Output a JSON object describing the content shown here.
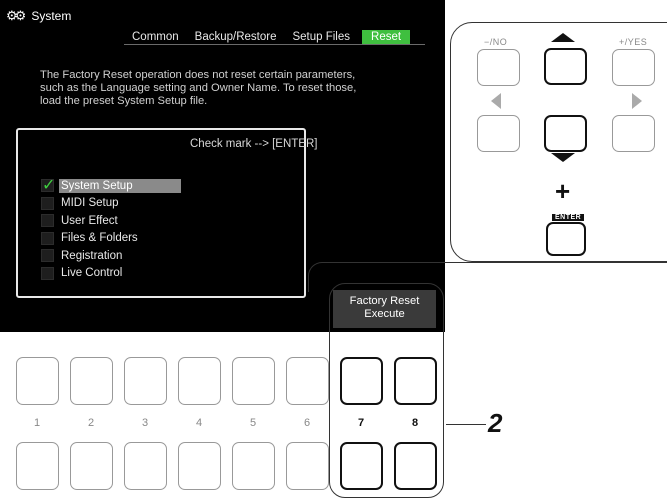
{
  "screen": {
    "title": "System",
    "tabs": [
      {
        "label": "Common",
        "active": false
      },
      {
        "label": "Backup/Restore",
        "active": false
      },
      {
        "label": "Setup Files",
        "active": false
      },
      {
        "label": "Reset",
        "active": true
      }
    ],
    "description": [
      "The Factory Reset operation does not reset certain parameters,",
      "such as the Language setting and Owner Name. To reset those,",
      "load the preset System Setup file."
    ],
    "panel_header": "Check mark --> [ENTER]",
    "items": [
      {
        "label": "System Setup",
        "checked": true,
        "selected": true
      },
      {
        "label": "MIDI Setup",
        "checked": false,
        "selected": false
      },
      {
        "label": "User Effect",
        "checked": false,
        "selected": false
      },
      {
        "label": "Files & Folders",
        "checked": false,
        "selected": false
      },
      {
        "label": "Registration",
        "checked": false,
        "selected": false
      },
      {
        "label": "Live Control",
        "checked": false,
        "selected": false
      }
    ],
    "soft_label_line1": "Factory Reset",
    "soft_label_line2": "Execute"
  },
  "panel_buttons": {
    "no_label": "−/NO",
    "yes_label": "+/YES",
    "enter_label": "ENTER",
    "plus_sign": "+"
  },
  "bottom_buttons": {
    "numbers": [
      "1",
      "2",
      "3",
      "4",
      "5",
      "6",
      "7",
      "8"
    ]
  },
  "step_number": "2",
  "colors": {
    "accent_green": "#3fbf3f",
    "lcd_background": "#000000"
  }
}
